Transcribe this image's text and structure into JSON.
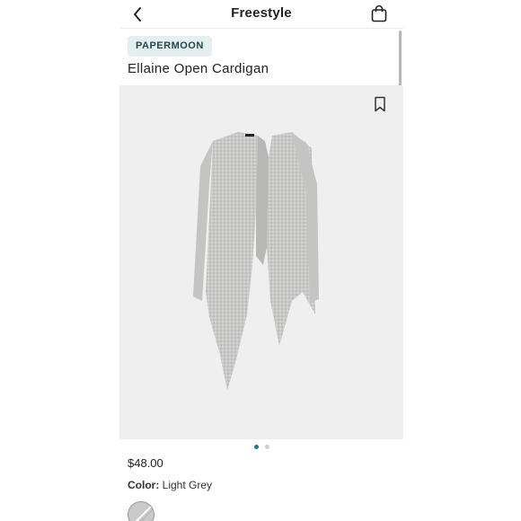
{
  "header": {
    "title": "Freestyle",
    "back_icon": "chevron-left-icon",
    "bag_icon": "shopping-bag-icon"
  },
  "product": {
    "brand": "PAPERMOON",
    "name": "Ellaine Open Cardigan",
    "price": "$48.00",
    "color_label": "Color:",
    "color_value": "Light Grey",
    "bookmark_icon": "bookmark-icon"
  },
  "gallery": {
    "current_index": 1,
    "total_images": 2
  },
  "colors": {
    "accent": "#1b7f7f",
    "badge_bg": "#e6efef",
    "image_bg": "#efefef"
  }
}
